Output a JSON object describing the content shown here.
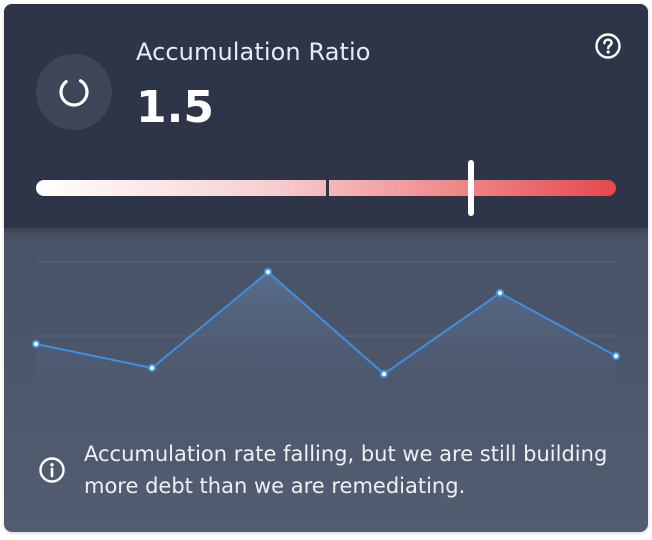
{
  "widget": {
    "title": "Accumulation Ratio",
    "value": "1.5",
    "help_icon": "question-circle-icon",
    "metric_icon": "loading-ring-icon",
    "info_icon": "info-circle-icon",
    "message": "Accumulation rate falling, but we are still building more debt than we are remediating."
  },
  "colors": {
    "header_bg": "#2e3548",
    "body_bg": "#4a5468",
    "line": "#3f8fe0",
    "bar_start": "#ffffff",
    "bar_end": "#e5484d"
  },
  "chart_data": {
    "type": "line",
    "x": [
      1,
      2,
      3,
      4,
      5,
      6
    ],
    "series": [
      {
        "values": [
          1.4,
          1.0,
          2.6,
          0.9,
          2.25,
          1.2
        ]
      }
    ],
    "ylim": [
      0,
      3
    ],
    "grid": true
  }
}
